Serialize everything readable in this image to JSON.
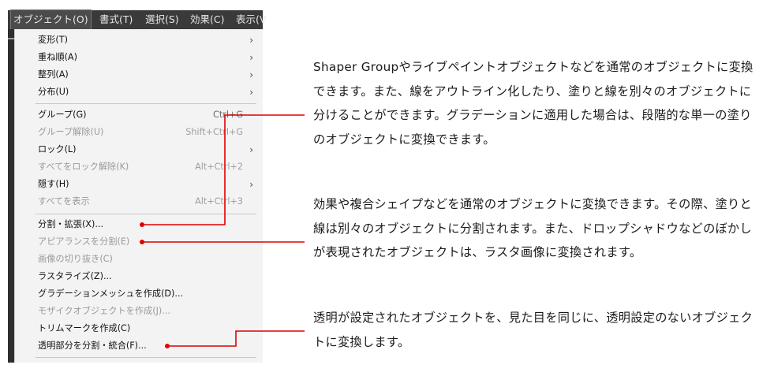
{
  "menubar": [
    {
      "label": "オブジェクト(O)",
      "active": true
    },
    {
      "label": "書式(T)"
    },
    {
      "label": "選択(S)"
    },
    {
      "label": "効果(C)"
    },
    {
      "label": "表示(V"
    }
  ],
  "menu": {
    "items": [
      {
        "label": "変形(T)",
        "submenu": true
      },
      {
        "label": "重ね順(A)",
        "submenu": true
      },
      {
        "label": "整列(A)",
        "submenu": true
      },
      {
        "label": "分布(U)",
        "submenu": true
      },
      {
        "label": "グループ(G)",
        "shortcut": "Ctrl+G"
      },
      {
        "label": "グループ解除(U)",
        "shortcut": "Shift+Ctrl+G",
        "disabled": true
      },
      {
        "label": "ロック(L)",
        "submenu": true
      },
      {
        "label": "すべてをロック解除(K)",
        "shortcut": "Alt+Ctrl+2",
        "disabled": true
      },
      {
        "label": "隠す(H)",
        "submenu": true
      },
      {
        "label": "すべてを表示",
        "shortcut": "Alt+Ctrl+3",
        "disabled": true
      },
      {
        "label": "分割・拡張(X)..."
      },
      {
        "label": "アピアランスを分割(E)",
        "disabled": true
      },
      {
        "label": "画像の切り抜き(C)",
        "disabled": true
      },
      {
        "label": "ラスタライズ(Z)..."
      },
      {
        "label": "グラデーションメッシュを作成(D)..."
      },
      {
        "label": "モザイクオブジェクトを作成(J)...",
        "disabled": true
      },
      {
        "label": "トリムマークを作成(C)"
      },
      {
        "label": "透明部分を分割・統合(F)..."
      }
    ]
  },
  "annotations": {
    "para1": "Shaper Groupやライブペイントオブジェクトなどを通常のオブジェクトに変換できます。また、線をアウトライン化したり、塗りと線を別々のオブジェクトに分けることができます。グラデーションに適用した場合は、段階的な単一の塗りのオブジェクトに変換できます。",
    "para2": "効果や複合シェイプなどを通常のオブジェクトに変換できます。その際、塗りと線は別々のオブジェクトに分割されます。また、ドロップシャドウなどのぼかしが表現されたオブジェクトは、ラスタ画像に変換されます。",
    "para3": "透明が設定されたオブジェクトを、見た目を同じに、透明設定のないオブジェクトに変換します。"
  },
  "colors": {
    "leader_line": "#e00000",
    "menubar_bg": "#3a3a3a",
    "menu_bg": "#f3f3f3"
  }
}
